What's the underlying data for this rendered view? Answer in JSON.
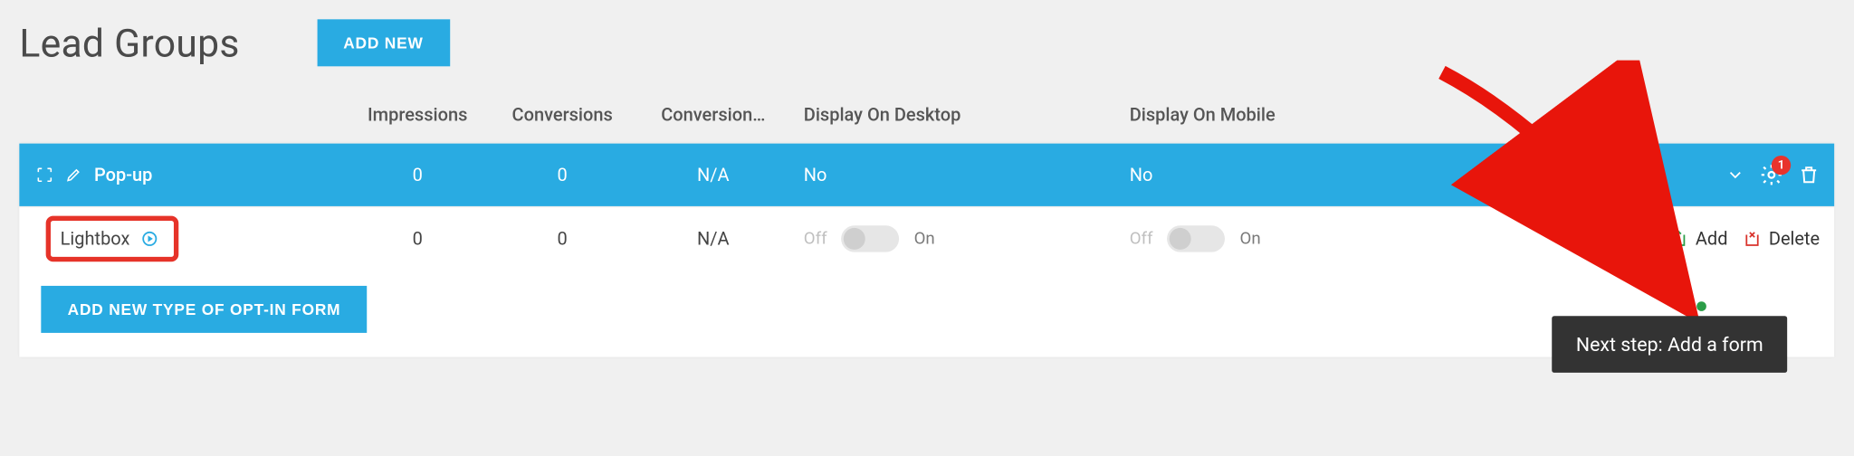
{
  "page": {
    "title": "Lead Groups"
  },
  "buttons": {
    "add_new": "ADD NEW",
    "add_new_form_type": "ADD NEW TYPE OF OPT-IN FORM"
  },
  "columns": {
    "impressions": "Impressions",
    "conversions": "Conversions",
    "conversion_rate": "Conversion…",
    "display_desktop": "Display On Desktop",
    "display_mobile": "Display On Mobile"
  },
  "group_row": {
    "name": "Pop-up",
    "impressions": "0",
    "conversions": "0",
    "conversion_rate": "N/A",
    "display_desktop": "No",
    "display_mobile": "No",
    "badge": "1"
  },
  "form_row": {
    "name": "Lightbox",
    "impressions": "0",
    "conversions": "0",
    "conversion_rate": "N/A",
    "toggle": {
      "off": "Off",
      "on": "On"
    },
    "actions": {
      "add": "Add",
      "delete": "Delete"
    }
  },
  "tooltip": {
    "text": "Next step: Add a form"
  }
}
